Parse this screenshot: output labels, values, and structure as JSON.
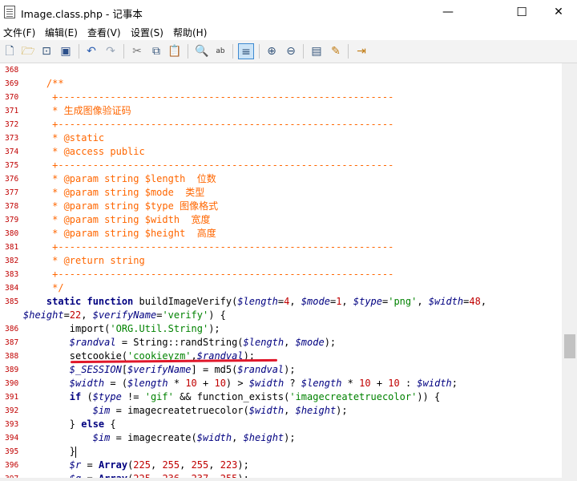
{
  "window": {
    "title": "Image.class.php - 记事本",
    "minimize_glyph": "—",
    "maximize_glyph": "☐",
    "close_glyph": "✕"
  },
  "menu": [
    {
      "label": "文件(F)"
    },
    {
      "label": "编辑(E)"
    },
    {
      "label": "查看(V)"
    },
    {
      "label": "设置(S)"
    },
    {
      "label": "帮助(H)"
    }
  ],
  "toolbar": {
    "icons": [
      "new-file-icon",
      "open-file-icon",
      "open-browse-icon",
      "save-icon",
      "undo-icon",
      "redo-icon",
      "cut-icon",
      "copy-icon",
      "paste-icon",
      "find-icon",
      "replace-icon",
      "word-wrap-icon",
      "zoom-in-icon",
      "zoom-out-icon",
      "properties-icon",
      "edit-icon",
      "exit-icon"
    ]
  },
  "lines": [
    {
      "num": "368",
      "tokens": []
    },
    {
      "num": "369",
      "tokens": [
        {
          "t": "    /**",
          "c": "c"
        }
      ]
    },
    {
      "num": "370",
      "tokens": [
        {
          "t": "     +----------------------------------------------------------",
          "c": "c"
        }
      ]
    },
    {
      "num": "371",
      "tokens": [
        {
          "t": "     * 生成图像验证码",
          "c": "c"
        }
      ]
    },
    {
      "num": "372",
      "tokens": [
        {
          "t": "     +----------------------------------------------------------",
          "c": "c"
        }
      ]
    },
    {
      "num": "373",
      "tokens": [
        {
          "t": "     * @static",
          "c": "c"
        }
      ]
    },
    {
      "num": "374",
      "tokens": [
        {
          "t": "     * @access public",
          "c": "c"
        }
      ]
    },
    {
      "num": "375",
      "tokens": [
        {
          "t": "     +----------------------------------------------------------",
          "c": "c"
        }
      ]
    },
    {
      "num": "376",
      "tokens": [
        {
          "t": "     * @param string $length  位数",
          "c": "c"
        }
      ]
    },
    {
      "num": "377",
      "tokens": [
        {
          "t": "     * @param string $mode  类型",
          "c": "c"
        }
      ]
    },
    {
      "num": "378",
      "tokens": [
        {
          "t": "     * @param string $type 图像格式",
          "c": "c"
        }
      ]
    },
    {
      "num": "379",
      "tokens": [
        {
          "t": "     * @param string $width  宽度",
          "c": "c"
        }
      ]
    },
    {
      "num": "380",
      "tokens": [
        {
          "t": "     * @param string $height  高度",
          "c": "c"
        }
      ]
    },
    {
      "num": "381",
      "tokens": [
        {
          "t": "     +----------------------------------------------------------",
          "c": "c"
        }
      ]
    },
    {
      "num": "382",
      "tokens": [
        {
          "t": "     * @return string",
          "c": "c"
        }
      ]
    },
    {
      "num": "383",
      "tokens": [
        {
          "t": "     +----------------------------------------------------------",
          "c": "c"
        }
      ]
    },
    {
      "num": "384",
      "tokens": [
        {
          "t": "     */",
          "c": "c"
        }
      ]
    },
    {
      "num": "385",
      "tokens": [
        {
          "t": "    static function ",
          "c": "k"
        },
        {
          "t": "buildImageVerify(",
          "c": "p"
        },
        {
          "t": "$length",
          "c": "v"
        },
        {
          "t": "=",
          "c": "o"
        },
        {
          "t": "4",
          "c": "n"
        },
        {
          "t": ", ",
          "c": "p"
        },
        {
          "t": "$mode",
          "c": "v"
        },
        {
          "t": "=",
          "c": "o"
        },
        {
          "t": "1",
          "c": "n"
        },
        {
          "t": ", ",
          "c": "p"
        },
        {
          "t": "$type",
          "c": "v"
        },
        {
          "t": "=",
          "c": "o"
        },
        {
          "t": "'png'",
          "c": "s"
        },
        {
          "t": ", ",
          "c": "p"
        },
        {
          "t": "$width",
          "c": "v"
        },
        {
          "t": "=",
          "c": "o"
        },
        {
          "t": "48",
          "c": "n"
        },
        {
          "t": ",",
          "c": "p"
        }
      ]
    },
    {
      "num": "",
      "tokens": [
        {
          "t": "$height",
          "c": "v"
        },
        {
          "t": "=",
          "c": "o"
        },
        {
          "t": "22",
          "c": "n"
        },
        {
          "t": ", ",
          "c": "p"
        },
        {
          "t": "$verifyName",
          "c": "v"
        },
        {
          "t": "=",
          "c": "o"
        },
        {
          "t": "'verify'",
          "c": "s"
        },
        {
          "t": ") {",
          "c": "p"
        }
      ]
    },
    {
      "num": "386",
      "tokens": [
        {
          "t": "        import(",
          "c": "p"
        },
        {
          "t": "'ORG.Util.String'",
          "c": "s"
        },
        {
          "t": ");",
          "c": "p"
        }
      ]
    },
    {
      "num": "387",
      "tokens": [
        {
          "t": "        ",
          "c": "p"
        },
        {
          "t": "$randval",
          "c": "v"
        },
        {
          "t": " = String::randString(",
          "c": "p"
        },
        {
          "t": "$length",
          "c": "v"
        },
        {
          "t": ", ",
          "c": "p"
        },
        {
          "t": "$mode",
          "c": "v"
        },
        {
          "t": ");",
          "c": "p"
        }
      ]
    },
    {
      "num": "388",
      "tokens": [
        {
          "t": "        setcookie(",
          "c": "p"
        },
        {
          "t": "'cookieyzm'",
          "c": "s"
        },
        {
          "t": ",",
          "c": "p"
        },
        {
          "t": "$randval",
          "c": "v"
        },
        {
          "t": ");",
          "c": "p"
        }
      ]
    },
    {
      "num": "389",
      "tokens": [
        {
          "t": "        ",
          "c": "p"
        },
        {
          "t": "$_SESSION",
          "c": "v"
        },
        {
          "t": "[",
          "c": "p"
        },
        {
          "t": "$verifyName",
          "c": "v"
        },
        {
          "t": "] = md5(",
          "c": "p"
        },
        {
          "t": "$randval",
          "c": "v"
        },
        {
          "t": ");",
          "c": "p"
        }
      ]
    },
    {
      "num": "390",
      "tokens": [
        {
          "t": "        ",
          "c": "p"
        },
        {
          "t": "$width",
          "c": "v"
        },
        {
          "t": " = (",
          "c": "p"
        },
        {
          "t": "$length",
          "c": "v"
        },
        {
          "t": " * ",
          "c": "p"
        },
        {
          "t": "10",
          "c": "n"
        },
        {
          "t": " + ",
          "c": "p"
        },
        {
          "t": "10",
          "c": "n"
        },
        {
          "t": ") > ",
          "c": "p"
        },
        {
          "t": "$width",
          "c": "v"
        },
        {
          "t": " ? ",
          "c": "p"
        },
        {
          "t": "$length",
          "c": "v"
        },
        {
          "t": " * ",
          "c": "p"
        },
        {
          "t": "10",
          "c": "n"
        },
        {
          "t": " + ",
          "c": "p"
        },
        {
          "t": "10",
          "c": "n"
        },
        {
          "t": " : ",
          "c": "p"
        },
        {
          "t": "$width",
          "c": "v"
        },
        {
          "t": ";",
          "c": "p"
        }
      ]
    },
    {
      "num": "391",
      "tokens": [
        {
          "t": "        ",
          "c": "p"
        },
        {
          "t": "if",
          "c": "k"
        },
        {
          "t": " (",
          "c": "p"
        },
        {
          "t": "$type",
          "c": "v"
        },
        {
          "t": " != ",
          "c": "p"
        },
        {
          "t": "'gif'",
          "c": "s"
        },
        {
          "t": " && function_exists(",
          "c": "p"
        },
        {
          "t": "'imagecreatetruecolor'",
          "c": "s"
        },
        {
          "t": ")) {",
          "c": "p"
        }
      ]
    },
    {
      "num": "392",
      "tokens": [
        {
          "t": "            ",
          "c": "p"
        },
        {
          "t": "$im",
          "c": "v"
        },
        {
          "t": " = imagecreatetruecolor(",
          "c": "p"
        },
        {
          "t": "$width",
          "c": "v"
        },
        {
          "t": ", ",
          "c": "p"
        },
        {
          "t": "$height",
          "c": "v"
        },
        {
          "t": ");",
          "c": "p"
        }
      ]
    },
    {
      "num": "393",
      "tokens": [
        {
          "t": "        } ",
          "c": "p"
        },
        {
          "t": "else",
          "c": "k"
        },
        {
          "t": " {",
          "c": "p"
        }
      ]
    },
    {
      "num": "394",
      "tokens": [
        {
          "t": "            ",
          "c": "p"
        },
        {
          "t": "$im",
          "c": "v"
        },
        {
          "t": " = imagecreate(",
          "c": "p"
        },
        {
          "t": "$width",
          "c": "v"
        },
        {
          "t": ", ",
          "c": "p"
        },
        {
          "t": "$height",
          "c": "v"
        },
        {
          "t": ");",
          "c": "p"
        }
      ]
    },
    {
      "num": "395",
      "tokens": [
        {
          "t": "        }",
          "c": "p"
        },
        {
          "t": "|",
          "c": "cursor"
        }
      ]
    },
    {
      "num": "396",
      "tokens": [
        {
          "t": "        ",
          "c": "p"
        },
        {
          "t": "$r",
          "c": "v"
        },
        {
          "t": " = ",
          "c": "p"
        },
        {
          "t": "Array",
          "c": "k"
        },
        {
          "t": "(",
          "c": "p"
        },
        {
          "t": "225",
          "c": "n"
        },
        {
          "t": ", ",
          "c": "p"
        },
        {
          "t": "255",
          "c": "n"
        },
        {
          "t": ", ",
          "c": "p"
        },
        {
          "t": "255",
          "c": "n"
        },
        {
          "t": ", ",
          "c": "p"
        },
        {
          "t": "223",
          "c": "n"
        },
        {
          "t": ");",
          "c": "p"
        }
      ]
    },
    {
      "num": "397",
      "tokens": [
        {
          "t": "        ",
          "c": "p"
        },
        {
          "t": "$g",
          "c": "v"
        },
        {
          "t": " = ",
          "c": "p"
        },
        {
          "t": "Array",
          "c": "k"
        },
        {
          "t": "(",
          "c": "p"
        },
        {
          "t": "225",
          "c": "n"
        },
        {
          "t": ", ",
          "c": "p"
        },
        {
          "t": "236",
          "c": "n"
        },
        {
          "t": ", ",
          "c": "p"
        },
        {
          "t": "237",
          "c": "n"
        },
        {
          "t": ", ",
          "c": "p"
        },
        {
          "t": "255",
          "c": "n"
        },
        {
          "t": ");",
          "c": "p"
        }
      ]
    }
  ]
}
